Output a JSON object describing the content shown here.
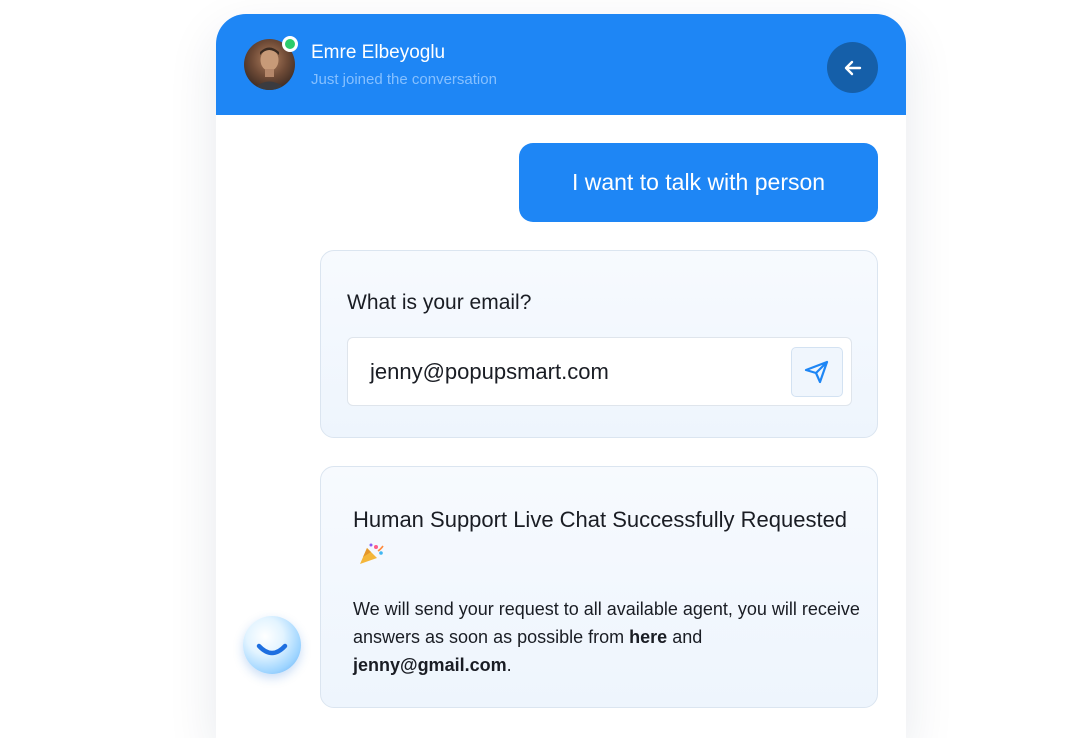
{
  "header": {
    "agent_name": "Emre Elbeyoglu",
    "agent_status": "Just joined the conversation",
    "online_color": "#2ccb6c",
    "brand_color": "#1e86f5",
    "back_icon": "arrow-left-icon"
  },
  "messages": {
    "user_message": "I want to talk with person",
    "email_prompt": {
      "question": "What is your email?",
      "email_value": "jenny@popupsmart.com",
      "send_icon": "paper-plane-icon"
    },
    "confirmation": {
      "title": "Human Support Live Chat Successfully Requested",
      "title_emoji": "party-popper",
      "body_text": "We will send your request to all available agent, you will receive answers as soon as possible from",
      "link_here": "here",
      "and_text": "and",
      "email": "jenny@gmail.com",
      "end_punct": "."
    }
  },
  "bot": {
    "avatar_icon": "smile-icon"
  }
}
